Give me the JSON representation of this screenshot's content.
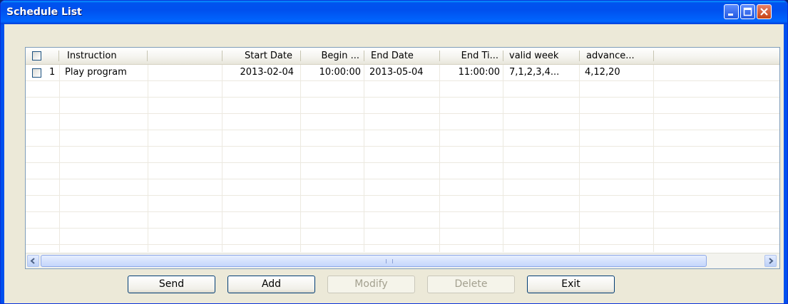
{
  "window": {
    "title": "Schedule List"
  },
  "columns": [
    "Instruction",
    "Start Date",
    "Begin ...",
    "End Date",
    "End Ti...",
    "valid week",
    "advance..."
  ],
  "rows": [
    {
      "index": "1",
      "instruction": "Play program",
      "start_date": "2013-02-04",
      "begin_time": "10:00:00",
      "end_date": "2013-05-04",
      "end_time": "11:00:00",
      "valid_week": "7,1,2,3,4...",
      "advance": "4,12,20"
    }
  ],
  "scrollbar": {
    "grip": "III"
  },
  "buttons": {
    "send": "Send",
    "add": "Add",
    "modify": "Modify",
    "delete": "Delete",
    "exit": "Exit"
  }
}
